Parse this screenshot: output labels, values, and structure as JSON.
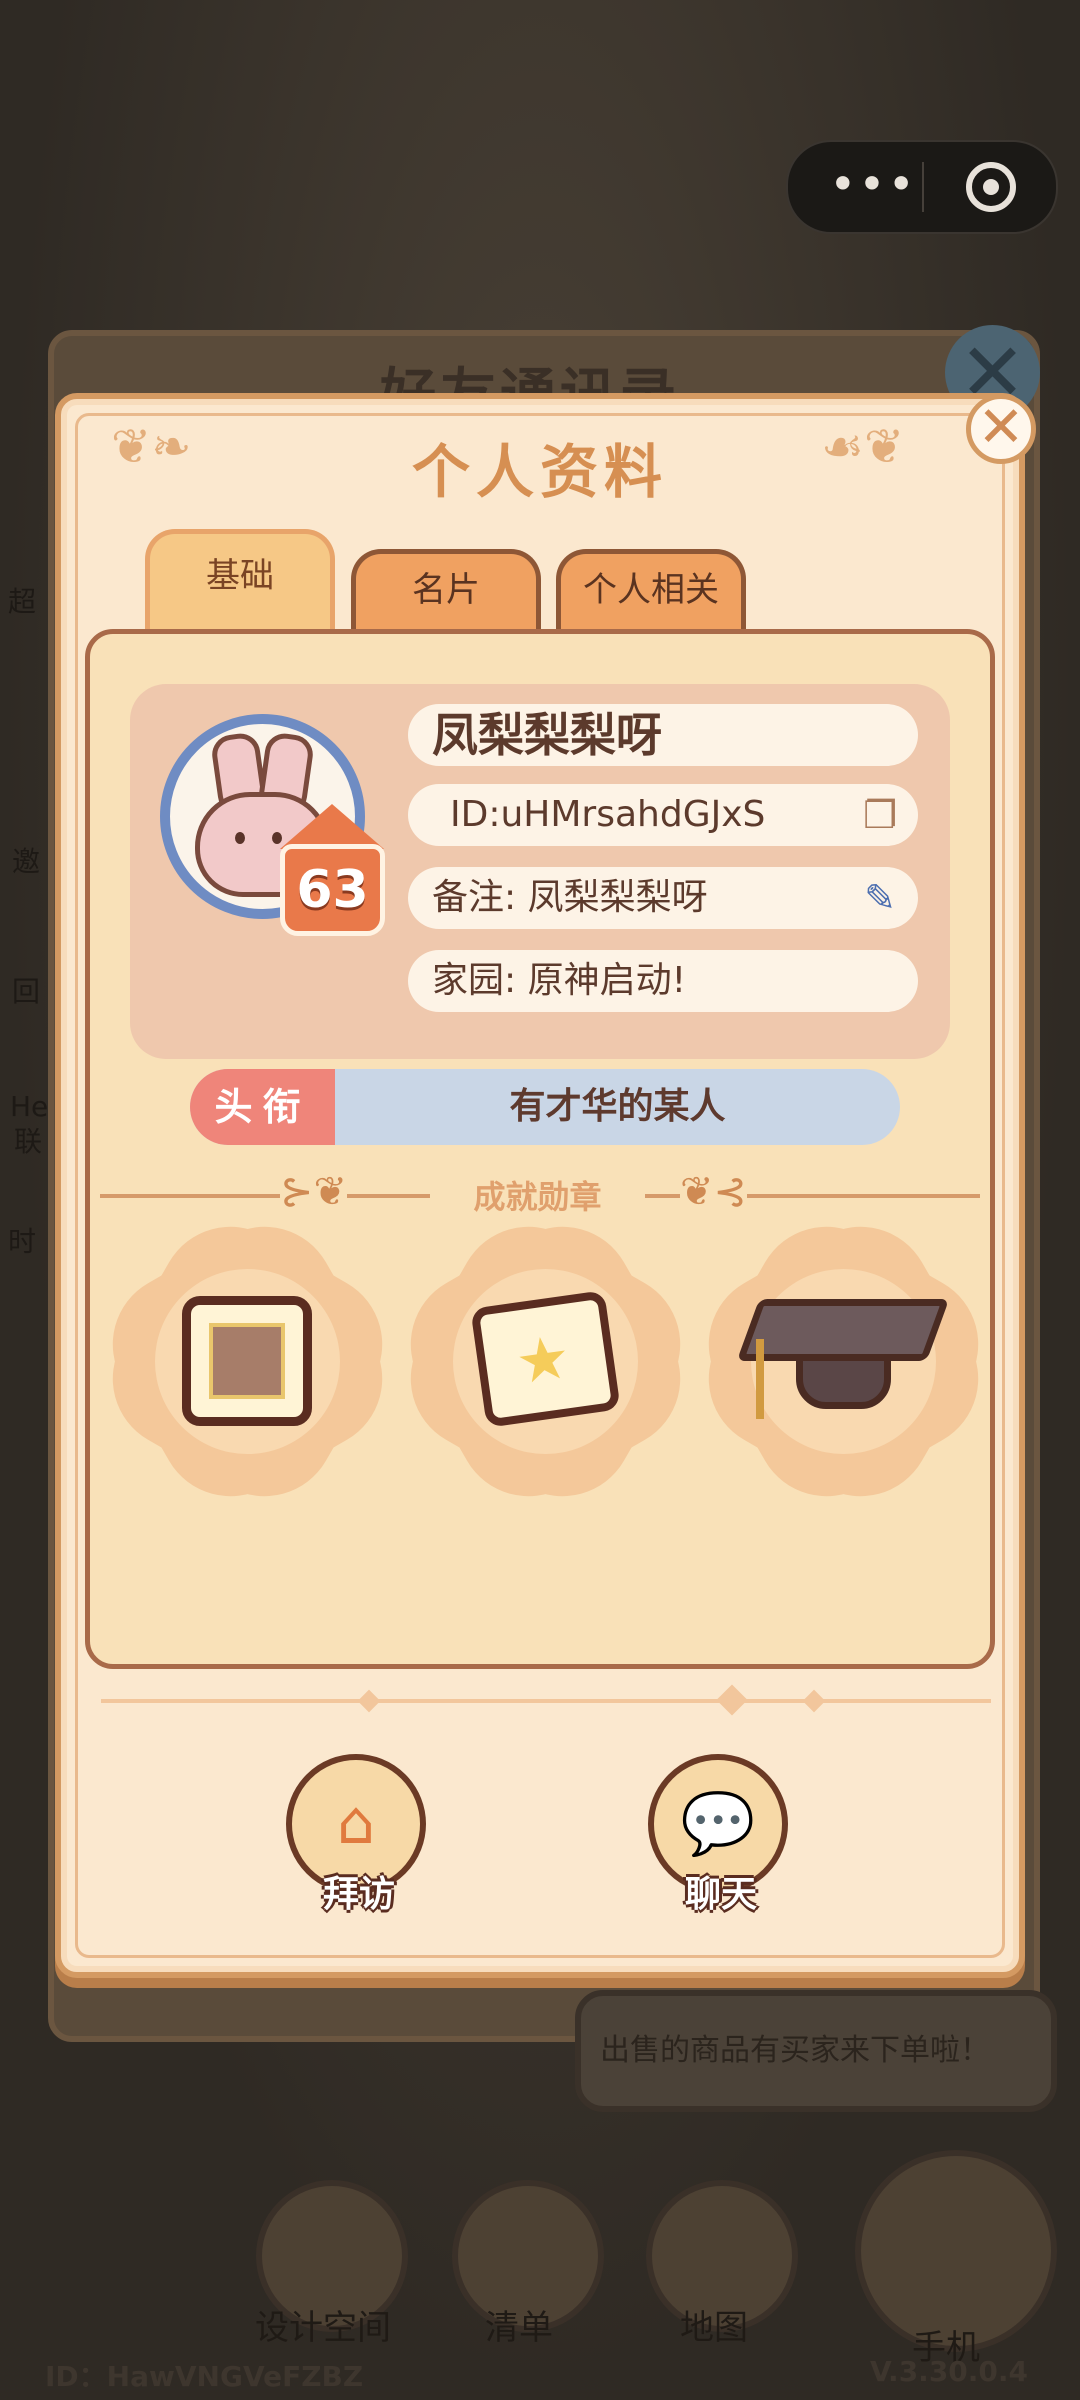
{
  "background": {
    "panel_title": "好友通讯录",
    "bubble_text": "出售的商品有买家来下单啦！",
    "side_labels": [
      "超",
      "邀",
      "回",
      "He",
      "联",
      "时"
    ],
    "nav": [
      {
        "label": "设计空间",
        "icon": "design-icon"
      },
      {
        "label": "清单",
        "icon": "list-icon"
      },
      {
        "label": "地图",
        "icon": "map-pin-icon"
      },
      {
        "label": "手机",
        "icon": "phone-icon"
      }
    ],
    "footer_id": "ID：HawVNGVeFZBZ",
    "version": "V.3.30.0.4"
  },
  "capsule": {
    "more": "•••",
    "close_icon": "target-icon"
  },
  "modal": {
    "title": "个人资料",
    "close": "✕",
    "tabs": [
      {
        "label": "基础",
        "active": true
      },
      {
        "label": "名片",
        "active": false
      },
      {
        "label": "个人相关",
        "active": false
      }
    ],
    "profile": {
      "name": "凤梨梨梨呀",
      "id": "ID:uHMrsahdGJxS",
      "note": "备注: 凤梨梨梨呀",
      "home": "家园: 原神启动!",
      "level": "63",
      "avatar_ring_color": "#6f8cc3"
    },
    "rank": {
      "label": "头衔",
      "value": "有才华的某人"
    },
    "achievements": {
      "title": "成就勋章",
      "medals": [
        {
          "name": "stamp-medal"
        },
        {
          "name": "star-scroll-medal"
        },
        {
          "name": "graduation-cap-medal"
        }
      ]
    },
    "actions": [
      {
        "label": "拜访",
        "icon": "visit-house-icon"
      },
      {
        "label": "聊天",
        "icon": "chat-bubble-icon"
      }
    ]
  }
}
